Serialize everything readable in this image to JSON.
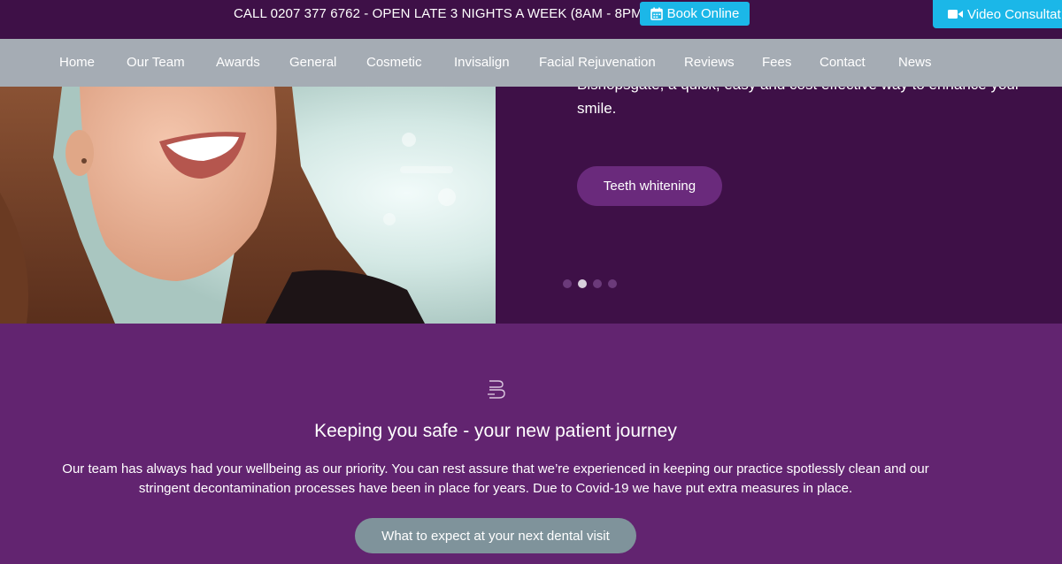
{
  "topbar": {
    "phone_text": "CALL 0207 377 6762 - OPEN LATE 3 NIGHTS A WEEK (8AM - 8PM)",
    "book_label": "Book Online",
    "video_label": "Video Consultat",
    "book_icon": "calendar-icon",
    "video_icon": "video-camera-icon"
  },
  "nav": {
    "items": [
      {
        "label": "Home"
      },
      {
        "label": "Our Team"
      },
      {
        "label": "Awards"
      },
      {
        "label": "General"
      },
      {
        "label": "Cosmetic"
      },
      {
        "label": "Invisalign"
      },
      {
        "label": "Facial Rejuvenation"
      },
      {
        "label": "Reviews"
      },
      {
        "label": "Fees"
      },
      {
        "label": "Contact"
      },
      {
        "label": "News"
      }
    ]
  },
  "hero": {
    "text_clipped": "Bishopsgate, a quick, easy and cost effective way to enhance your",
    "text_visible": "smile.",
    "button_label": "Teeth whitening",
    "slide_count": 4,
    "active_slide": 2
  },
  "section": {
    "icon": "brand-logo-icon",
    "title": "Keeping you safe - your new patient journey",
    "text_line1": "Our team has always had your wellbeing as our priority. You can rest assure that we’re experienced in keeping our practice spotlessly clean and our",
    "text_line2": "stringent decontamination processes have been in place for years. Due to Covid-19 we have put extra measures in place.",
    "button_label": "What to expect at your next dental visit"
  },
  "colors": {
    "topbar_bg": "#3e1047",
    "accent_blue": "#1bb7e8",
    "nav_bg": "#a5acb4",
    "section_bg": "#622470",
    "hero_button": "#6a2a7c",
    "cta_button": "#7f939b"
  }
}
